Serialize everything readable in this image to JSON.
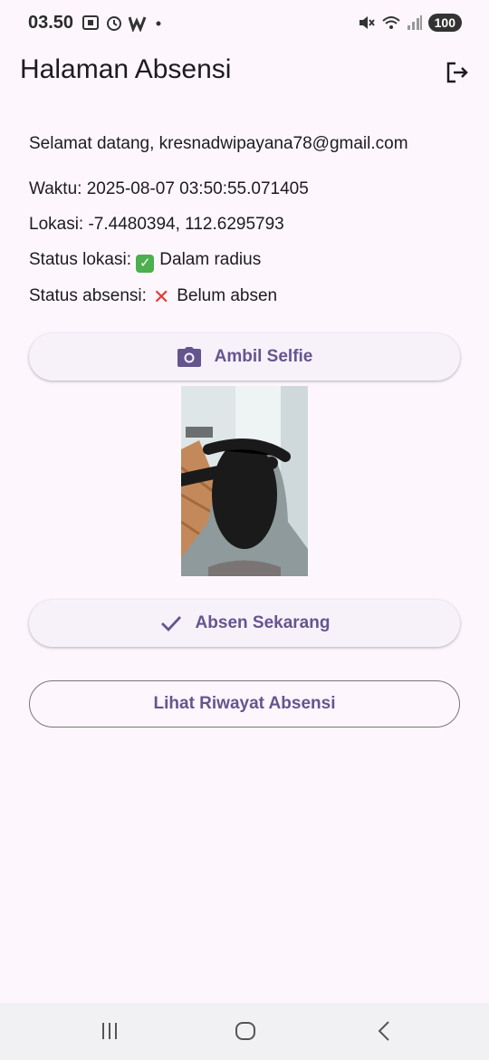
{
  "status_bar": {
    "time": "03.50",
    "battery": "100"
  },
  "app_bar": {
    "title": "Halaman Absensi"
  },
  "info": {
    "welcome": "Selamat datang, kresnadwipayana78@gmail.com",
    "waktu": "Waktu: 2025-08-07 03:50:55.071405",
    "lokasi": "Lokasi: -7.4480394, 112.6295793",
    "status_lokasi_label": "Status lokasi:",
    "status_lokasi_value": "Dalam radius",
    "status_absensi_label": "Status absensi:",
    "status_absensi_value": "Belum absen"
  },
  "buttons": {
    "selfie": "Ambil Selfie",
    "absen": "Absen Sekarang",
    "riwayat": "Lihat Riwayat Absensi"
  },
  "colors": {
    "background": "#fdf7fd",
    "accent": "#65558f",
    "check_green": "#4caf50",
    "cross_red": "#e53935"
  },
  "icons": {
    "logout": "logout-icon",
    "camera": "camera-icon",
    "check": "check-icon"
  }
}
